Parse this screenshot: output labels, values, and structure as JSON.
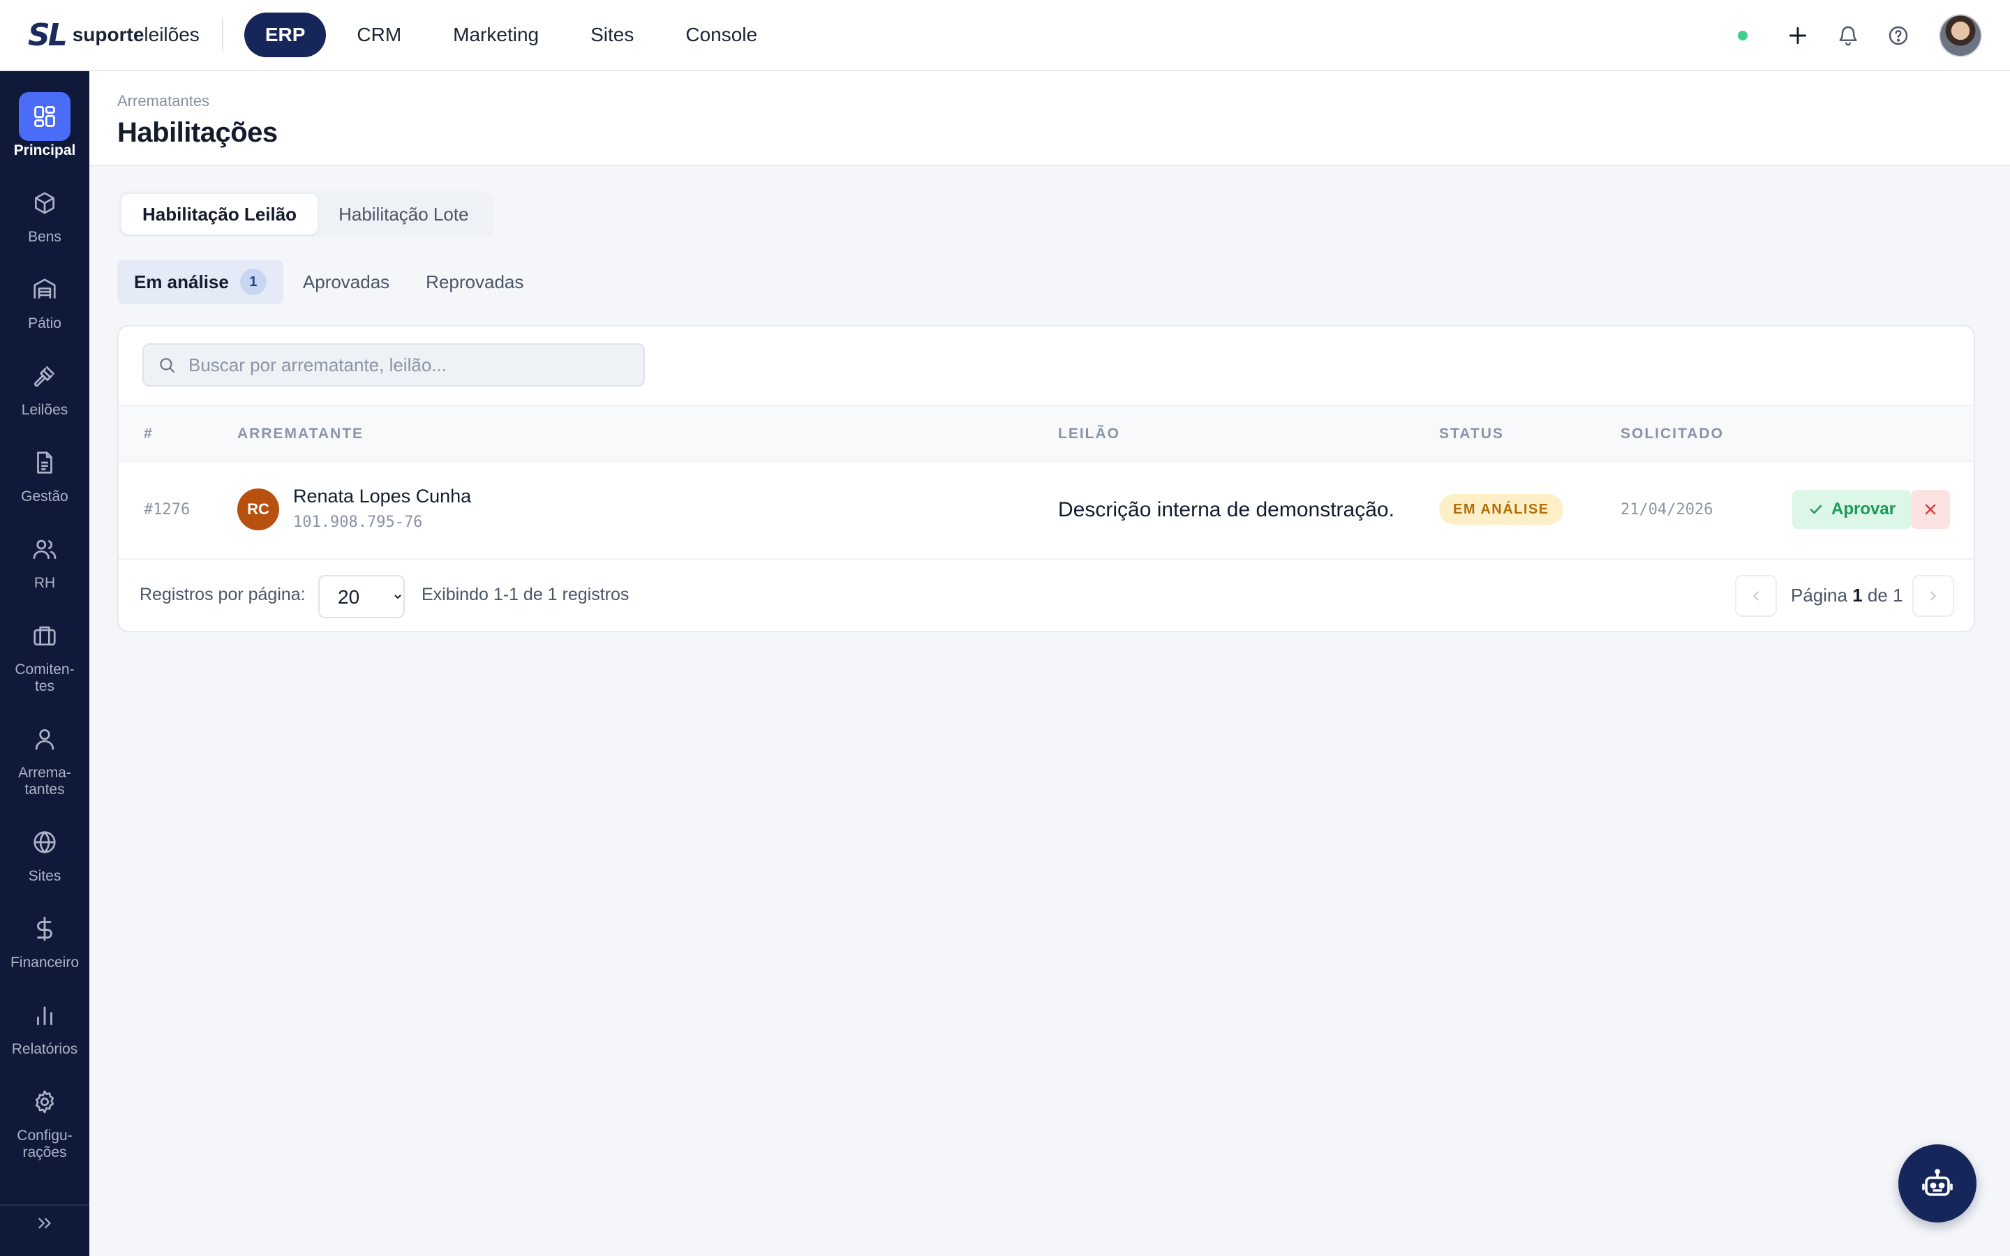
{
  "brand": {
    "mark": "SL",
    "name_bold": "suporte",
    "name_light": "leilões"
  },
  "topnav": [
    {
      "label": "ERP",
      "active": true
    },
    {
      "label": "CRM"
    },
    {
      "label": "Marketing"
    },
    {
      "label": "Sites"
    },
    {
      "label": "Console"
    }
  ],
  "sidebar": [
    {
      "label": "Principal",
      "icon": "grid-icon",
      "active": true
    },
    {
      "label": "Bens",
      "icon": "box-icon"
    },
    {
      "label": "Pátio",
      "icon": "warehouse-icon"
    },
    {
      "label": "Leilões",
      "icon": "gavel-icon"
    },
    {
      "label": "Gestão",
      "icon": "document-icon"
    },
    {
      "label": "RH",
      "icon": "users-icon"
    },
    {
      "label": "Comiten-\ntes",
      "icon": "briefcase-icon"
    },
    {
      "label": "Arrema-\ntantes",
      "icon": "user-icon"
    },
    {
      "label": "Sites",
      "icon": "globe-icon"
    },
    {
      "label": "Financeiro",
      "icon": "dollar-icon"
    },
    {
      "label": "Relatórios",
      "icon": "bar-chart-icon"
    },
    {
      "label": "Configu-\nrações",
      "icon": "gear-icon"
    }
  ],
  "header": {
    "breadcrumb": "Arrematantes",
    "title": "Habilitações"
  },
  "tabs": [
    {
      "label": "Habilitação Leilão",
      "active": true
    },
    {
      "label": "Habilitação Lote"
    }
  ],
  "subtabs": [
    {
      "label": "Em análise",
      "badge": "1",
      "active": true
    },
    {
      "label": "Aprovadas"
    },
    {
      "label": "Reprovadas"
    }
  ],
  "search": {
    "placeholder": "Buscar por arrematante, leilão..."
  },
  "table": {
    "columns": [
      "#",
      "ARREMATANTE",
      "LEILÃO",
      "STATUS",
      "SOLICITADO"
    ],
    "rows": [
      {
        "id": "#1276",
        "initials": "RC",
        "name": "Renata Lopes Cunha",
        "cpf": "101.908.795-76",
        "leilao": "Descrição interna de demonstração.",
        "status": "EM ANÁLISE",
        "date": "21/04/2026",
        "approve_label": "Aprovar"
      }
    ]
  },
  "footer": {
    "rpp_label": "Registros por página:",
    "rpp_value": "20",
    "showing": "Exibindo 1-1 de 1 registros",
    "page_prefix": "Página",
    "page_current": "1",
    "page_of": "de",
    "page_total": "1"
  },
  "colors": {
    "accent": "#16255a",
    "sidebar_bg": "#0f1a3a",
    "sidebar_active": "#4a6cf7",
    "status_warning_bg": "#fdf0c9",
    "approve_bg": "#dcf6e8",
    "reject_bg": "#fde2e2",
    "online": "#3ecf8e"
  }
}
